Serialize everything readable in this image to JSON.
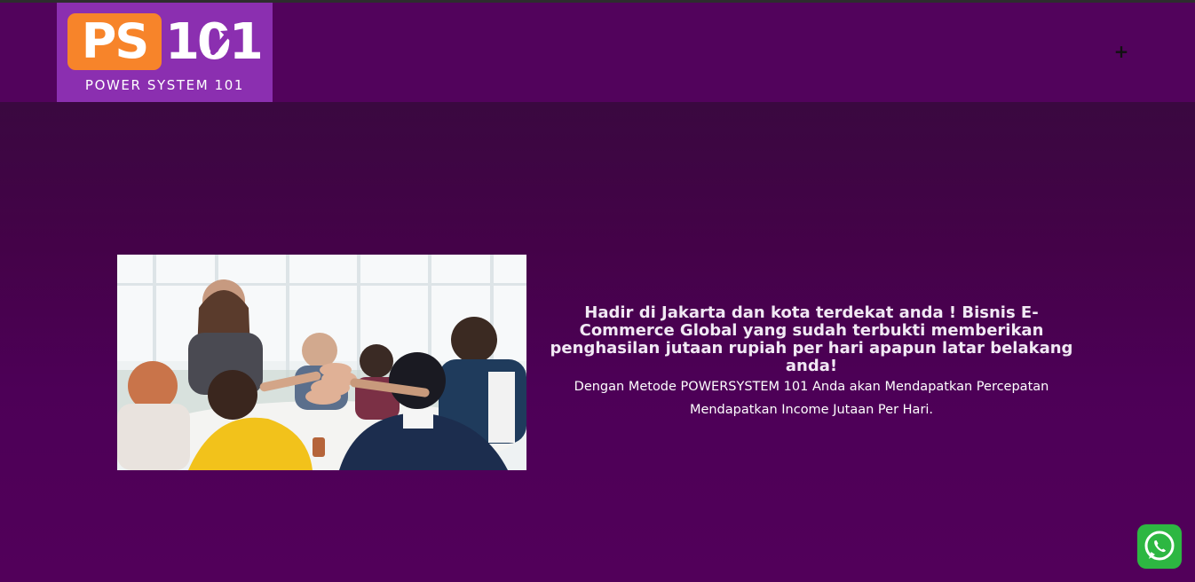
{
  "logo": {
    "mark_ps": "PS",
    "mark_number": "101",
    "caption": "POWER SYSTEM 101",
    "colors": {
      "background": "#8b2fb0",
      "ps_box": "#f7842a",
      "text": "#ffffff"
    }
  },
  "header": {
    "menu_icon": "plus-icon",
    "menu_glyph": "+",
    "background": "#52035c"
  },
  "hero": {
    "headline": "Hadir di Jakarta dan kota terdekat anda ! Bisnis E-Commerce Global yang sudah terbukti memberikan penghasilan jutaan rupiah per hari apapun latar belakang anda!",
    "subtext": "Dengan Metode POWERSYSTEM 101 Anda akan Mendapatkan Percepatan Mendapatkan Income Jutaan Per Hari.",
    "image": "team-high-five-photo",
    "background": "#4d0057"
  },
  "whatsapp": {
    "icon": "whatsapp-icon",
    "color": "#2db742"
  }
}
